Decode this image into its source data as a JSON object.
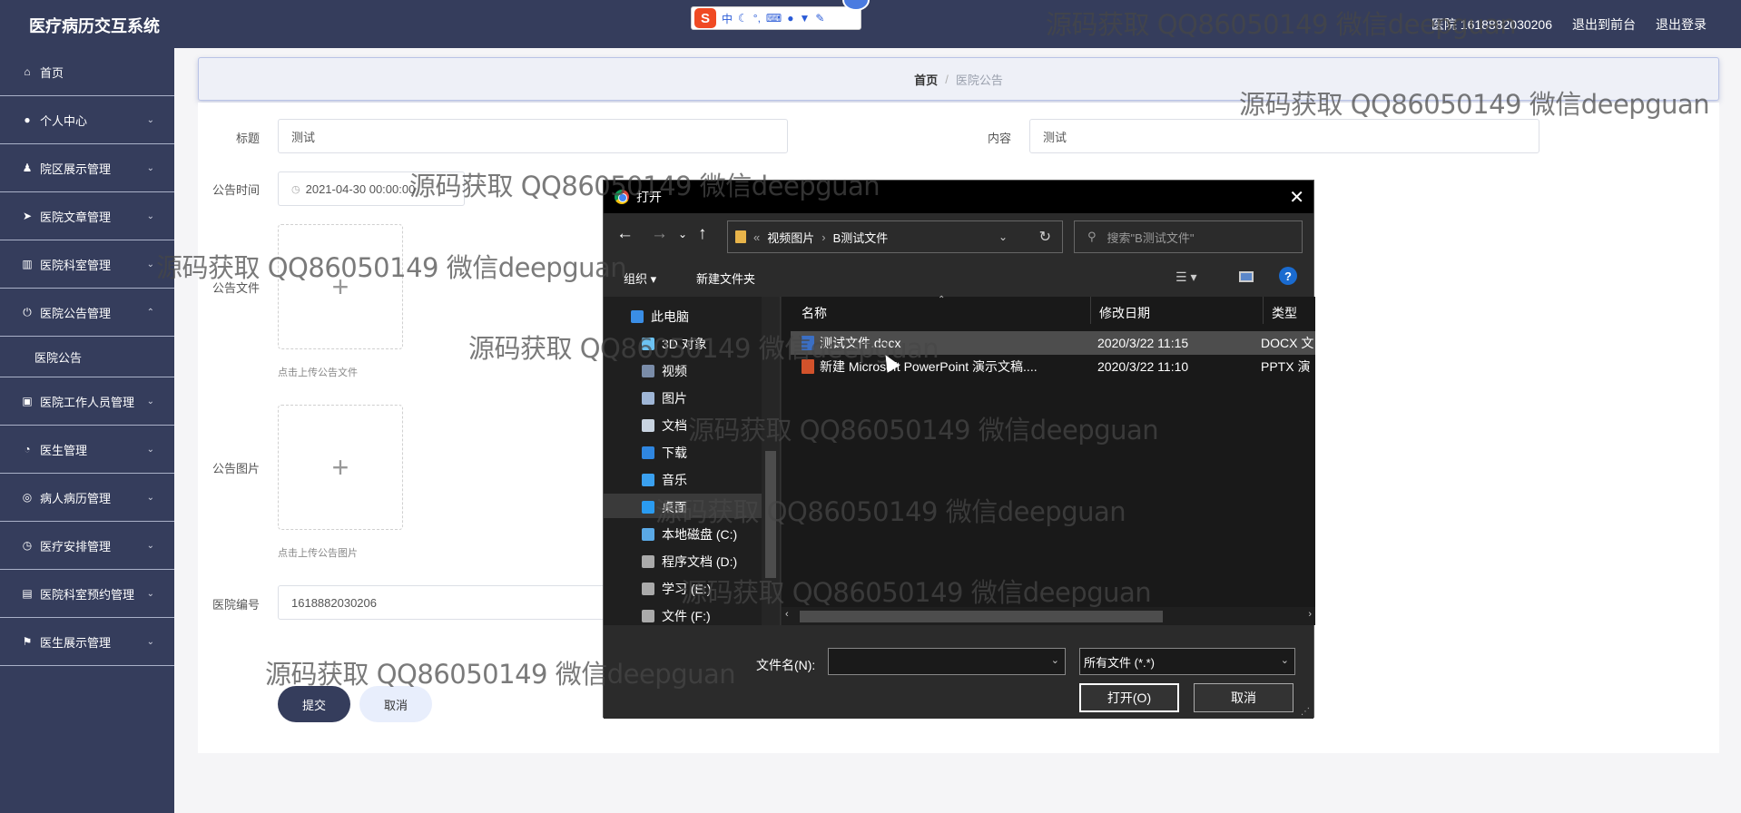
{
  "topbar": {
    "title": "医疗病历交互系统",
    "user": "医院 1618882030206",
    "exit_front": "退出到前台",
    "logout": "退出登录"
  },
  "ime": {
    "logo": "S",
    "chinese_mode": "中"
  },
  "sidebar": {
    "items": [
      {
        "label": "首页",
        "icon": "home-icon"
      },
      {
        "label": "个人中心",
        "icon": "user-icon"
      },
      {
        "label": "院区展示管理",
        "icon": "person-icon"
      },
      {
        "label": "医院文章管理",
        "icon": "send-icon"
      },
      {
        "label": "医院科室管理",
        "icon": "chart-icon"
      },
      {
        "label": "医院公告管理",
        "icon": "power-icon"
      },
      {
        "label": "医院工作人员管理",
        "icon": "lock-icon"
      },
      {
        "label": "医生管理",
        "icon": "gauge-icon"
      },
      {
        "label": "病人病历管理",
        "icon": "target-icon"
      },
      {
        "label": "医疗安排管理",
        "icon": "clock-icon"
      },
      {
        "label": "医院科室预约管理",
        "icon": "clipboard-icon"
      },
      {
        "label": "医生展示管理",
        "icon": "flag-icon"
      }
    ],
    "sub_item": "医院公告"
  },
  "breadcrumb": {
    "home": "首页",
    "sep": "/",
    "current": "医院公告"
  },
  "form": {
    "title_label": "标题",
    "title_value": "测试",
    "content_label": "内容",
    "content_value": "测试",
    "time_label": "公告时间",
    "time_value": "2021-04-30 00:00:00",
    "file_label": "公告文件",
    "file_hint": "点击上传公告文件",
    "image_label": "公告图片",
    "image_hint": "点击上传公告图片",
    "plus": "+",
    "hospital_no_label": "医院编号",
    "hospital_no_value": "1618882030206",
    "submit": "提交",
    "cancel": "取消"
  },
  "watermark": "源码获取 QQ86050149 微信deepguan",
  "dialog": {
    "title": "打开",
    "close": "✕",
    "path": [
      "视频图片",
      "B测试文件"
    ],
    "path_prefix": "«",
    "path_sep": "›",
    "search_placeholder": "搜索\"B测试文件\"",
    "organize": "组织 ▾",
    "new_folder": "新建文件夹",
    "nav_items": [
      "此电脑",
      "3D 对象",
      "视频",
      "图片",
      "文档",
      "下载",
      "音乐",
      "桌面",
      "本地磁盘 (C:)",
      "程序文档 (D:)",
      "学习 (E:)",
      "文件 (F:)"
    ],
    "columns": [
      "名称",
      "修改日期",
      "类型"
    ],
    "files": [
      {
        "name": "测试文件.docx",
        "date": "2020/3/22 11:15",
        "type": "DOCX 文"
      },
      {
        "name": "新建 Microsoft PowerPoint 演示文稿....",
        "date": "2020/3/22 11:10",
        "type": "PPTX 演"
      }
    ],
    "filename_label": "文件名(N):",
    "filetype": "所有文件 (*.*)",
    "open_button": "打开(O)",
    "cancel_button": "取消"
  }
}
